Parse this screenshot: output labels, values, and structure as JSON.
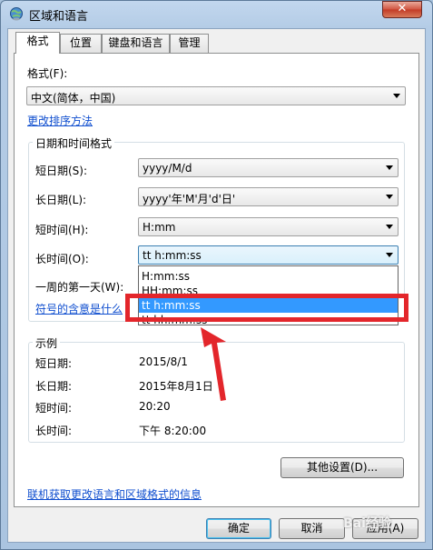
{
  "window": {
    "title": "区域和语言",
    "close_glyph": "✕"
  },
  "tabs": [
    {
      "label": "格式",
      "active": true
    },
    {
      "label": "位置",
      "active": false
    },
    {
      "label": "键盘和语言",
      "active": false
    },
    {
      "label": "管理",
      "active": false
    }
  ],
  "format": {
    "label": "格式(F):",
    "value": "中文(简体，中国)",
    "sort_link": "更改排序方法"
  },
  "datetime_group": {
    "title": "日期和时间格式",
    "short_date": {
      "label": "短日期(S):",
      "value": "yyyy/M/d"
    },
    "long_date": {
      "label": "长日期(L):",
      "value": "yyyy'年'M'月'd'日'"
    },
    "short_time": {
      "label": "短时间(H):",
      "value": "H:mm"
    },
    "long_time": {
      "label": "长时间(O):",
      "value": "tt h:mm:ss"
    },
    "first_day_label": "一周的第一天(W):",
    "symbols_link": "符号的含意是什么"
  },
  "dropdown": {
    "options": [
      "H:mm:ss",
      "HH:mm:ss",
      "tt h:mm:ss",
      "tt hh:mm:ss"
    ],
    "selected_index": 2
  },
  "example": {
    "title": "示例",
    "short_date": {
      "label": "短日期:",
      "value": "2015/8/1"
    },
    "long_date": {
      "label": "长日期:",
      "value": "2015年8月1日"
    },
    "short_time": {
      "label": "短时间:",
      "value": "20:20"
    },
    "long_time": {
      "label": "长时间:",
      "value": "下午 8:20:00"
    }
  },
  "other_settings_button": "其他设置(D)...",
  "online_link": "联机获取更改语言和区域格式的信息",
  "buttons": {
    "ok": "确定",
    "cancel": "取消",
    "apply": "应用(A)"
  },
  "watermark": "Bai经验",
  "colors": {
    "highlight_box": "#e3262b",
    "selection": "#3399ff",
    "link": "#0f4ecf"
  }
}
